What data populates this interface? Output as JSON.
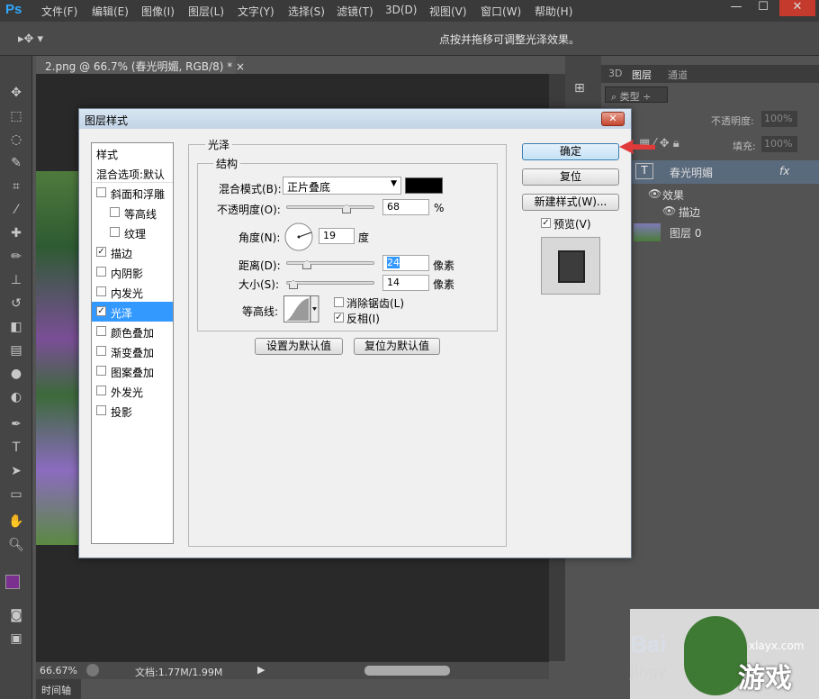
{
  "menubar": {
    "logo": "Ps",
    "items": [
      "文件(F)",
      "编辑(E)",
      "图像(I)",
      "图层(L)",
      "文字(Y)",
      "选择(S)",
      "滤镜(T)",
      "3D(D)",
      "视图(V)",
      "窗口(W)",
      "帮助(H)"
    ],
    "window_controls": [
      "—",
      "☐",
      "✕"
    ]
  },
  "optionsbar": {
    "hint": "点按并拖移可调整光泽效果。"
  },
  "document": {
    "tab_title": "2.png @ 66.7% (春光明媚, RGB/8) *",
    "zoom": "66.67%",
    "doc_size": "文档:1.77M/1.99M"
  },
  "timeline_label": "时间轴",
  "layers_panel": {
    "tabs": [
      "3D",
      "图层",
      "通道"
    ],
    "filter_label": "类型",
    "opacity_label": "不透明度:",
    "opacity_value": "100%",
    "fill_label": "填充:",
    "fill_value": "100%",
    "layers": [
      {
        "name": "春光明媚",
        "type_badge": "T",
        "fx": "fx"
      },
      {
        "name": "效果"
      },
      {
        "name": "描边"
      },
      {
        "name": "图层 0"
      }
    ]
  },
  "dialog": {
    "title": "图层样式",
    "close": "✕",
    "style_list": [
      {
        "label": "样式",
        "checkbox": false,
        "checked": false,
        "selected": false
      },
      {
        "label": "混合选项:默认",
        "checkbox": false,
        "checked": false,
        "selected": false
      },
      {
        "label": "斜面和浮雕",
        "checkbox": true,
        "checked": false,
        "selected": false
      },
      {
        "label": "等高线",
        "checkbox": true,
        "checked": false,
        "selected": false,
        "indent": true
      },
      {
        "label": "纹理",
        "checkbox": true,
        "checked": false,
        "selected": false,
        "indent": true
      },
      {
        "label": "描边",
        "checkbox": true,
        "checked": true,
        "selected": false
      },
      {
        "label": "内阴影",
        "checkbox": true,
        "checked": false,
        "selected": false
      },
      {
        "label": "内发光",
        "checkbox": true,
        "checked": false,
        "selected": false
      },
      {
        "label": "光泽",
        "checkbox": true,
        "checked": true,
        "selected": true
      },
      {
        "label": "颜色叠加",
        "checkbox": true,
        "checked": false,
        "selected": false
      },
      {
        "label": "渐变叠加",
        "checkbox": true,
        "checked": false,
        "selected": false
      },
      {
        "label": "图案叠加",
        "checkbox": true,
        "checked": false,
        "selected": false
      },
      {
        "label": "外发光",
        "checkbox": true,
        "checked": false,
        "selected": false
      },
      {
        "label": "投影",
        "checkbox": true,
        "checked": false,
        "selected": false
      }
    ],
    "section_title": "光泽",
    "structure_title": "结构",
    "blend_mode_label": "混合模式(B):",
    "blend_mode_value": "正片叠底",
    "blend_color": "#000000",
    "opacity_label": "不透明度(O):",
    "opacity_value": "68",
    "opacity_unit": "%",
    "angle_label": "角度(N):",
    "angle_value": "19",
    "angle_unit": "度",
    "distance_label": "距离(D):",
    "distance_value": "24",
    "distance_unit": "像素",
    "size_label": "大小(S):",
    "size_value": "14",
    "size_unit": "像素",
    "contour_label": "等高线:",
    "antialias_label": "消除锯齿(L)",
    "antialias_checked": false,
    "invert_label": "反相(I)",
    "invert_checked": true,
    "set_default": "设置为默认值",
    "reset_default": "复位为默认值",
    "ok": "确定",
    "reset": "复位",
    "new_style": "新建样式(W)...",
    "preview_label": "预览(V)",
    "preview_checked": true
  },
  "watermark": {
    "baidu": "Bai",
    "jingyan": "jingy",
    "site": "xlayx.com",
    "game": "游戏"
  },
  "colors": {
    "foreground": "#7b2f8e",
    "background": "#ffffff",
    "arrow": "#e03a3a"
  }
}
